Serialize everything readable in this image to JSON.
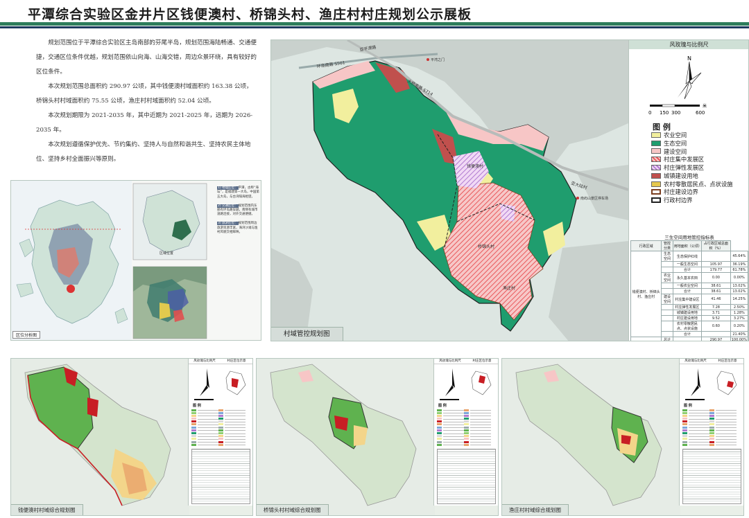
{
  "header": {
    "title": "平潭综合实验区金井片区钱便澳村、桥锦头村、渔庄村村庄规划公示展板",
    "accent_green": "#2e7d5b",
    "accent_navy": "#1d3b5e"
  },
  "intro": {
    "paragraphs": [
      "规划范围位于平潭综合实验区主岛南部的芬尾半岛，规划范围海陆畅通、交通便捷，交通区位条件优越，规划范围依山向海、山海交错，周边众景环绕，具有较好的区位条件。",
      "本次规划范围总面积约 290.97 公顷，其中钱便澳村域面积约 163.38 公顷，桥锦头村村域面积约 75.55 公顷，渔庄村村域面积约 52.04 公顷。",
      "本次规划期限为 2021-2035 年，其中近期为 2021-2025 年，远期为 2026-2035 年。",
      "本次规划遵循保护优先、节约集约、坚持人与自然和谐共生、坚持农民主体地位、坚持乡村全面振兴等原则。"
    ]
  },
  "location_panel": {
    "caption": "区位分析图",
    "inset_label": "区域位置",
    "notes": [
      {
        "tag": "1) 地理区位：",
        "text": "平潭，古称“海坛”，是福建第一大岛，中国第五大岛，与台湾隔海相望。"
      },
      {
        "tag": "2) 交通区位：",
        "text": "规划范围内东部有环岛路穿越，南侧有城市道路连接，对外交通便捷。"
      },
      {
        "tag": "3) 旅游区位：",
        "text": "规划范围周边旅游资源丰富，海湾沙滩与渔村风貌交相辉映。"
      }
    ]
  },
  "main_map": {
    "caption": "村域管控规划图",
    "road_labels": [
      "环岛南路 S501",
      "大桥南路 S714",
      "亚平澳路",
      "亚大陆村"
    ],
    "place_labels": [
      "钱便澳村",
      "桥锦头村",
      "渔庄村",
      "平湾之门",
      "南屿山景区停车场"
    ],
    "legend": {
      "header": "风玫瑰与比例尺",
      "north": "N",
      "scale_ticks": [
        "0",
        "150",
        "300",
        "600"
      ],
      "scale_unit": "米",
      "title": "图 例",
      "items": [
        {
          "label": "农业空间",
          "color": "#f2ef9e"
        },
        {
          "label": "生态空间",
          "color": "#1f9d6e"
        },
        {
          "label": "建设空间",
          "color": "#f7c6c6"
        },
        {
          "label": "村庄集中发展区",
          "color": "#e8575a"
        },
        {
          "label": "村庄弹性发展区",
          "color": "#b07ad0"
        },
        {
          "label": "城镇建设用地",
          "color": "#c0504d"
        },
        {
          "label": "农村零散居民点、点状设施",
          "color": "#e6c84e"
        },
        {
          "label": "村庄建设边界",
          "color": "#7b3f20"
        },
        {
          "label": "行政村边界",
          "color": "#222222"
        }
      ]
    },
    "table": {
      "title": "三生空间用地管控指标表",
      "headers": [
        "行政区域",
        "管控分类",
        "用地面积（公顷）",
        "占行政区域总面积（%）"
      ],
      "region": "钱便澳村、桥锦头村、渔庄村",
      "rows": [
        [
          "生态空间",
          "生态保护红线",
          "",
          "45.64%"
        ],
        [
          "",
          "一般生态空间",
          "105.97",
          "36.19%"
        ],
        [
          "",
          "合计",
          "179.77",
          "61.78%"
        ],
        [
          "农业空间",
          "永久基本农田",
          "0.00",
          "0.00%"
        ],
        [
          "",
          "一般农业空间",
          "38.61",
          "13.02%"
        ],
        [
          "",
          "合计",
          "38.61",
          "13.02%"
        ],
        [
          "建设空间",
          "村庄集中建设区",
          "41.46",
          "14.25%"
        ],
        [
          "",
          "村庄弹性发展区",
          "7.28",
          "2.50%"
        ],
        [
          "",
          "城镇建设用地",
          "3.71",
          "1.28%"
        ],
        [
          "",
          "村庄建设用地",
          "9.52",
          "3.27%"
        ],
        [
          "",
          "农村零散居民点、点状设施",
          "0.60",
          "0.20%"
        ],
        [
          "",
          "合计",
          "",
          "21.40%"
        ],
        [
          "总计",
          "",
          "290.97",
          "100.00%"
        ]
      ]
    }
  },
  "bottom_maps": [
    {
      "caption": "钱便澳村村域综合规划图",
      "header_left": "风玫瑰与比例尺",
      "header_right": "村庄区位示意",
      "legend_title": "图 例",
      "highlight": "#e8403a"
    },
    {
      "caption": "桥锦头村村域综合规划图",
      "header_left": "风玫瑰与比例尺",
      "header_right": "村庄区位示意",
      "legend_title": "图 例",
      "highlight": "#e8403a"
    },
    {
      "caption": "渔庄村村域综合规划图",
      "header_left": "风玫瑰与比例尺",
      "header_right": "村庄区位示意",
      "legend_title": "图 例",
      "highlight": "#e8403a"
    }
  ]
}
